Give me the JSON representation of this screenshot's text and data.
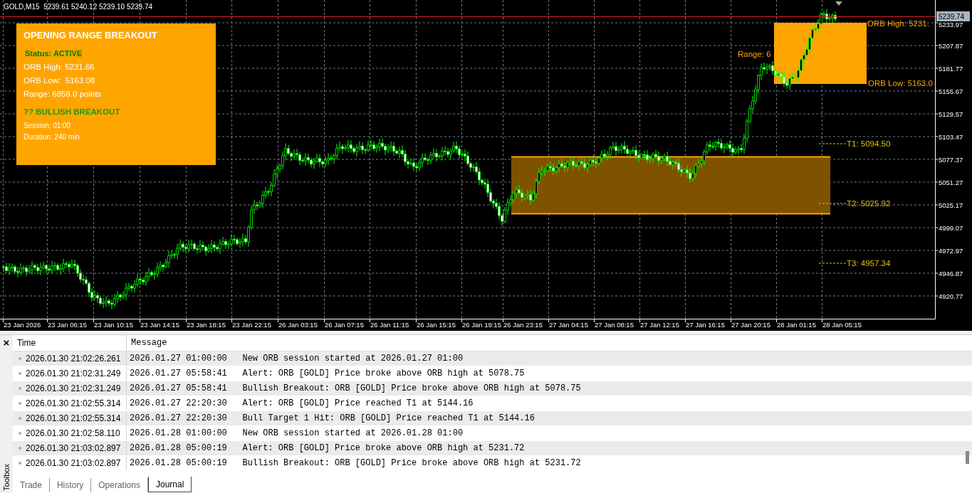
{
  "chart": {
    "symbol_line": "GOLD,M15  5239.61 5240.12 5239.10 5239.74",
    "current_price": "5239.74",
    "price_ticks": [
      "5233.97",
      "5207.87",
      "5181.77",
      "5155.67",
      "5129.57",
      "5103.47",
      "5077.37",
      "5051.27",
      "5025.17",
      "4999.07",
      "4972.97",
      "4946.87",
      "4920.77"
    ],
    "time_ticks": [
      "23 Jan 2026",
      "23 Jan 06:15",
      "23 Jan 10:15",
      "23 Jan 14:15",
      "23 Jan 18:15",
      "23 Jan 22:15",
      "26 Jan 03:15",
      "26 Jan 07:15",
      "26 Jan 11:15",
      "26 Jan 15:15",
      "26 Jan 19:15",
      "26 Jan 23:15",
      "27 Jan 04:15",
      "27 Jan 08:15",
      "27 Jan 12:15",
      "27 Jan 16:15",
      "27 Jan 20:15",
      "28 Jan 01:15",
      "28 Jan 05:15"
    ],
    "info_panel": {
      "title": "OPENING RANGE BREAKOUT",
      "status": "Status: ACTIVE",
      "lines": [
        "ORB High: 5231.66",
        "ORB Low:  5163.08",
        "Range: 6858.0 points"
      ],
      "signal": "?? BULLISH BREAKOUT",
      "details": [
        "Session: 01:00",
        "Duration: 240 min"
      ]
    },
    "orb_labels": {
      "high": "ORB High: 5231.",
      "low": "ORB Low: 5163.0",
      "range": "Range: 6"
    },
    "targets": [
      {
        "label": "T1: 5094.50"
      },
      {
        "label": "T2: 5025.92"
      },
      {
        "label": "T3: 4957.34"
      }
    ]
  },
  "toolbox": {
    "close": "×",
    "title": "Toolbox",
    "columns": [
      "Time",
      "Message"
    ],
    "rows": [
      {
        "time": "2026.01.30 21:02:26.261",
        "message": "2026.01.27 01:00:00   New ORB session started at 2026.01.27 01:00"
      },
      {
        "time": "2026.01.30 21:02:31.249",
        "message": "2026.01.27 05:58:41   Alert: ORB [GOLD] Price broke above ORB high at 5078.75"
      },
      {
        "time": "2026.01.30 21:02:31.249",
        "message": "2026.01.27 05:58:41   Bullish Breakout: ORB [GOLD] Price broke above ORB high at 5078.75"
      },
      {
        "time": "2026.01.30 21:02:55.314",
        "message": "2026.01.27 22:20:30   Alert: ORB [GOLD] Price reached T1 at 5144.16"
      },
      {
        "time": "2026.01.30 21:02:55.314",
        "message": "2026.01.27 22:20:30   Bull Target 1 Hit: ORB [GOLD] Price reached T1 at 5144.16"
      },
      {
        "time": "2026.01.30 21:02:58.110",
        "message": "2026.01.28 01:00:00   New ORB session started at 2026.01.28 01:00"
      },
      {
        "time": "2026.01.30 21:03:02.897",
        "message": "2026.01.28 05:00:19   Alert: ORB [GOLD] Price broke above ORB high at 5231.72"
      },
      {
        "time": "2026.01.30 21:03:02.897",
        "message": "2026.01.28 05:00:19   Bullish Breakout: ORB [GOLD] Price broke above ORB high at 5231.72"
      }
    ],
    "tabs": [
      {
        "label": "Trade",
        "selected": false
      },
      {
        "label": "History",
        "selected": false
      },
      {
        "label": "Operations",
        "selected": false
      },
      {
        "label": "Journal",
        "selected": true
      }
    ]
  }
}
